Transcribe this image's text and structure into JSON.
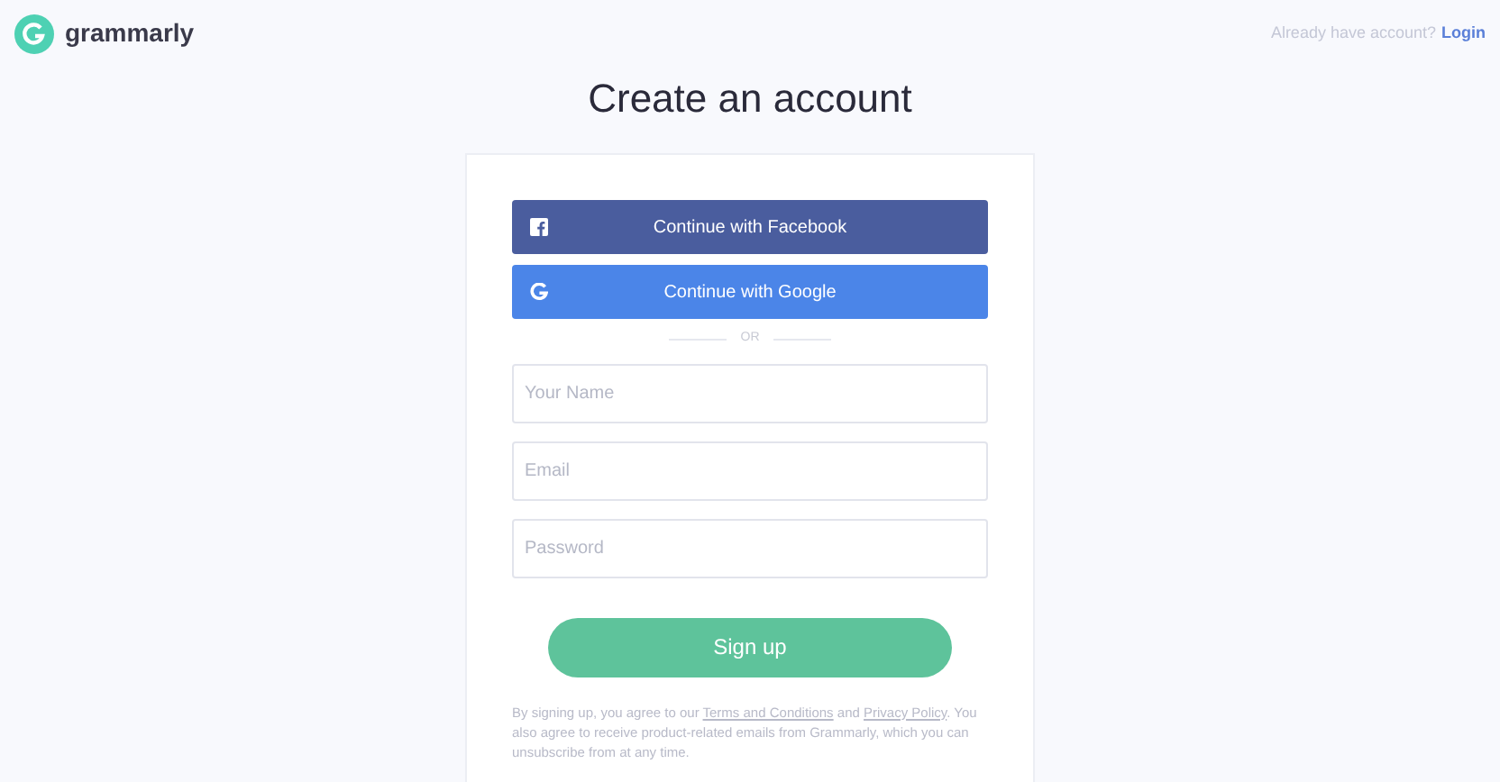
{
  "header": {
    "logo_text": "grammarly",
    "prompt": "Already have account?",
    "login_link": "Login"
  },
  "title": "Create an account",
  "social_buttons": [
    {
      "kind": "facebook",
      "label": "Continue with Facebook"
    },
    {
      "kind": "google",
      "label": "Continue with Google"
    }
  ],
  "divider": "OR",
  "fields": [
    {
      "placeholder": "Your Name"
    },
    {
      "placeholder": "Email"
    },
    {
      "placeholder": "Password"
    }
  ],
  "submit": "Sign up",
  "legal": {
    "before": "By signing up, you agree to our ",
    "terms_link": "Terms and Conditions",
    "middle": " and ",
    "privacy_link": "Privacy Policy",
    "after": ". You also agree to receive product-related emails from Grammarly, which you can unsubscribe from at any time."
  }
}
